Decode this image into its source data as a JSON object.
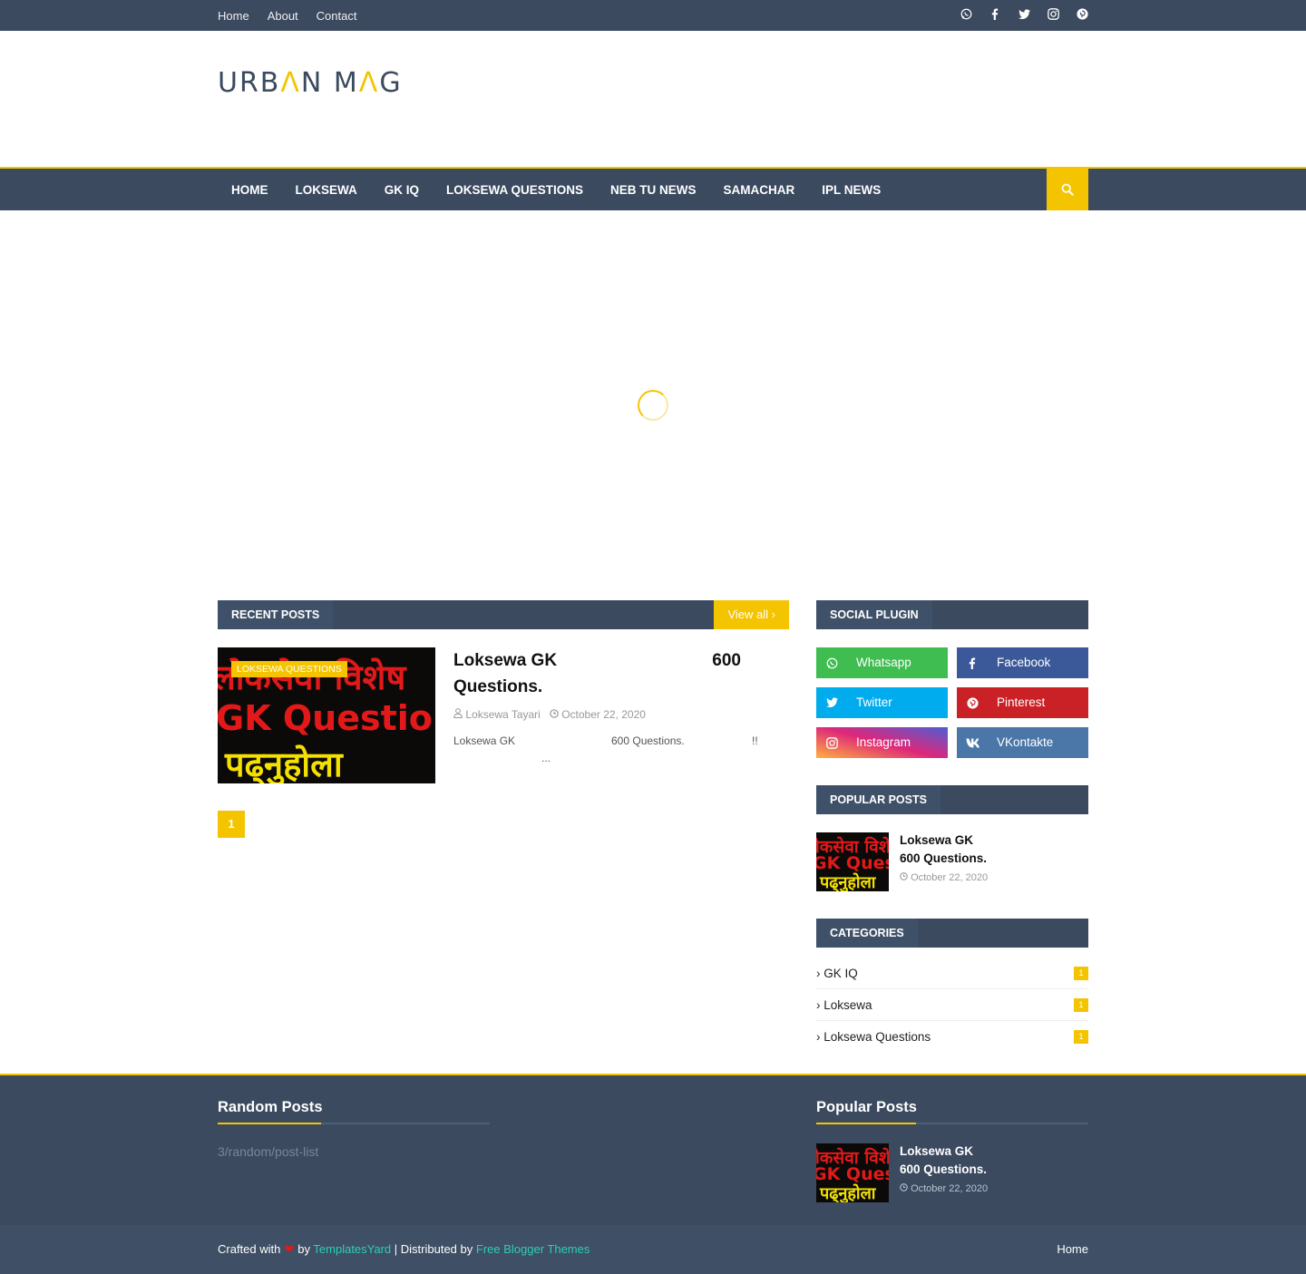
{
  "topbar": {
    "links": [
      "Home",
      "About",
      "Contact"
    ],
    "social_icons": [
      "whatsapp-icon",
      "facebook-icon",
      "twitter-icon",
      "instagram-icon",
      "pinterest-icon"
    ]
  },
  "header": {
    "logo_part1": "URB",
    "logo_accent1": "Λ",
    "logo_part2": "N M",
    "logo_accent2": "Λ",
    "logo_part3": "G"
  },
  "nav": {
    "items": [
      "Home",
      "Loksewa",
      "GK IQ",
      "Loksewa Questions",
      "NEB TU News",
      "Samachar",
      "IPL News"
    ],
    "search_icon": "search-icon"
  },
  "recent": {
    "title": "Recent Posts",
    "view_all": "View all",
    "post": {
      "thumb_line1": "लोकसेवा विशेष",
      "thumb_line2": "GK Question",
      "thumb_line3": "पढ्नुहोला",
      "badge": "Loksewa Questions",
      "title_line1": "Loksewa GK",
      "title_num": "600",
      "title_line2": "Questions.",
      "author": "Loksewa Tayari",
      "date": "October 22, 2020",
      "snippet_a": "Loksewa GK",
      "snippet_b": "600 Questions.",
      "snippet_c": "!!",
      "snippet_d": "..."
    },
    "page": "1"
  },
  "social_plugin": {
    "title": "Social Plugin",
    "buttons": [
      "Whatsapp",
      "Facebook",
      "Twitter",
      "Pinterest",
      "Instagram",
      "VKontakte"
    ]
  },
  "popular": {
    "title": "Popular Posts",
    "post": {
      "thumb_line1": "लोकसेवा विशेष",
      "thumb_line2": "GK Question",
      "thumb_line3": "पढ्नुहोला",
      "title_line1": "Loksewa GK",
      "title_line2": "600 Questions.",
      "date": "October 22, 2020"
    }
  },
  "categories": {
    "title": "Categories",
    "items": [
      {
        "label": "GK IQ",
        "count": "1"
      },
      {
        "label": "Loksewa",
        "count": "1"
      },
      {
        "label": "Loksewa Questions",
        "count": "1"
      }
    ]
  },
  "footer": {
    "random_title": "Random Posts",
    "random_text": "3/random/post-list",
    "popular_title": "Popular Posts",
    "post": {
      "title_line1": "Loksewa GK",
      "title_line2": "600 Questions.",
      "date": "October 22, 2020"
    }
  },
  "bottom": {
    "crafted": "Crafted with",
    "by": "by",
    "templatesyard": "TemplatesYard",
    "distributed": "| Distributed by",
    "free_themes": "Free Blogger Themes",
    "home": "Home"
  },
  "colors": {
    "primary": "#3b4a5f",
    "accent": "#f5c400",
    "footer_link": "#2ad0b4"
  }
}
